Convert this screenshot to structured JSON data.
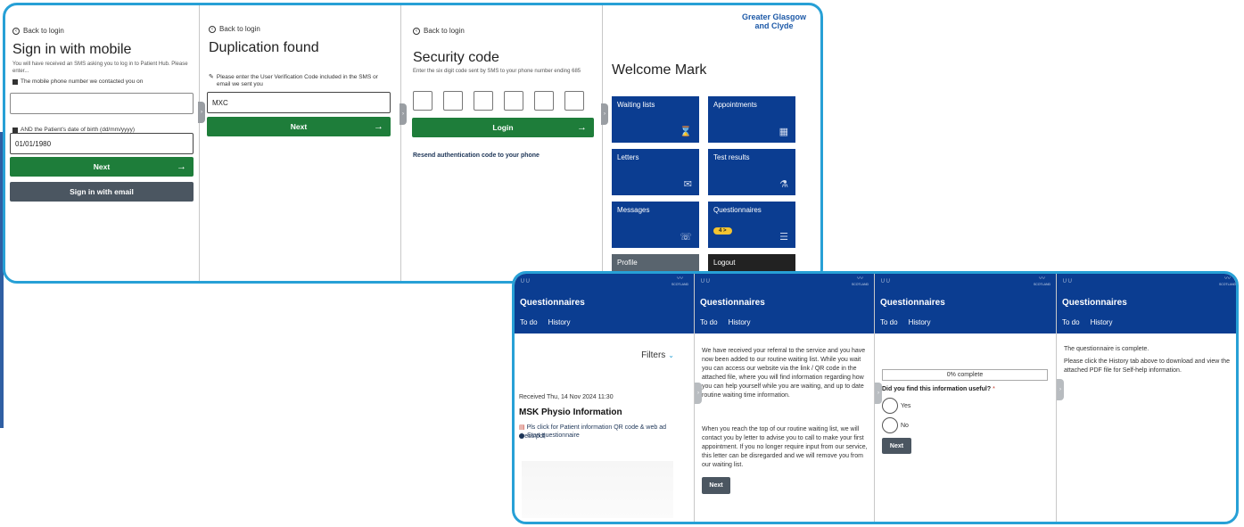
{
  "colors": {
    "navy": "#0b3d91",
    "green": "#1e7d3a",
    "frame": "#27a0d6",
    "grey_button": "#4b5661"
  },
  "screen1": {
    "back": "Back to login",
    "title": "Sign in with mobile",
    "intro": "You will have received an SMS asking you to log in to Patient Hub. Please enter...",
    "phone_label": "The mobile phone number we contacted you on",
    "phone_value": "",
    "dob_label": "AND the Patient's date of birth (dd/mm/yyyy)",
    "dob_value": "01/01/1980",
    "next": "Next",
    "email_button": "Sign in with email"
  },
  "screen2": {
    "back": "Back to login",
    "title": "Duplication found",
    "label": "Please enter the User Verification Code included in the SMS or email we sent you",
    "code_value": "MXC",
    "next": "Next"
  },
  "screen3": {
    "back": "Back to login",
    "title": "Security code",
    "hint": "Enter the six digit code sent by SMS to your phone number ending 685",
    "login": "Login",
    "resend": "Resend authentication code to your phone"
  },
  "screen4": {
    "brand_line1": "Greater Glasgow",
    "brand_line2": "and Clyde",
    "welcome": "Welcome Mark",
    "tiles": {
      "waiting": "Waiting lists",
      "appointments": "Appointments",
      "letters": "Letters",
      "test_results": "Test results",
      "messages": "Messages",
      "questionnaires": "Questionnaires",
      "questionnaires_badge": "4 >",
      "profile": "Profile",
      "logout": "Logout"
    }
  },
  "q_common": {
    "title": "Questionnaires",
    "tab_todo": "To do",
    "tab_history": "History",
    "scotland": "SCOTLAND"
  },
  "q1": {
    "filters": "Filters",
    "received": "Received Thu, 14 Nov 2024 11:30",
    "heading": "MSK Physio Information",
    "pdf": "Pls click for Patient information QR code & web ad dress.pdf",
    "start": "Start questionnaire"
  },
  "q2": {
    "para1": "We have received your referral to the service and you have now been added to our routine waiting list. While you wait you can access our website via the link / QR code in the attached file, where you will find information regarding how you can help yourself while you are waiting, and up to date routine waiting time information.",
    "para2": "When you reach the top of our routine waiting list, we will contact you by letter to advise you to call to make your first appointment. If you no longer require input from our service, this letter can be disregarded and we will remove you from our waiting list.",
    "next": "Next"
  },
  "q3": {
    "progress": "0% complete",
    "question": "Did you find this information useful?",
    "required_mark": "*",
    "yes": "Yes",
    "no": "No",
    "next": "Next"
  },
  "q4": {
    "complete": "The questionnaire is complete.",
    "instructions": "Please click the History tab above to download and view the attached PDF file for Self-help information."
  }
}
